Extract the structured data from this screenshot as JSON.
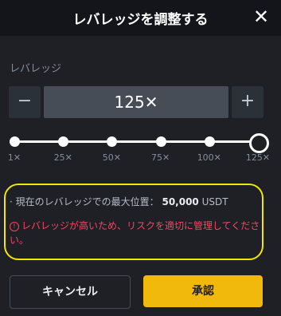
{
  "header": {
    "title": "レバレッジを調整する",
    "close_glyph": "✕"
  },
  "leverage": {
    "label": "レバレッジ",
    "minus": "−",
    "plus": "+",
    "value": "125✕",
    "ticks": [
      "1✕",
      "25✕",
      "50✕",
      "75✕",
      "100✕",
      "125✕"
    ],
    "selected_index": 5
  },
  "info": {
    "max_position_label": "· 現在のレバレッジでの最大位置：",
    "max_position_value": "50,000",
    "max_position_unit": "USDT",
    "warning_icon": "!",
    "warning_text": "レバレッジが高いため、リスクを適切に管理してください。"
  },
  "buttons": {
    "cancel": "キャンセル",
    "confirm": "承認"
  },
  "colors": {
    "accent": "#f0b90b",
    "warning": "#f6465d",
    "highlight": "#f3e600"
  }
}
